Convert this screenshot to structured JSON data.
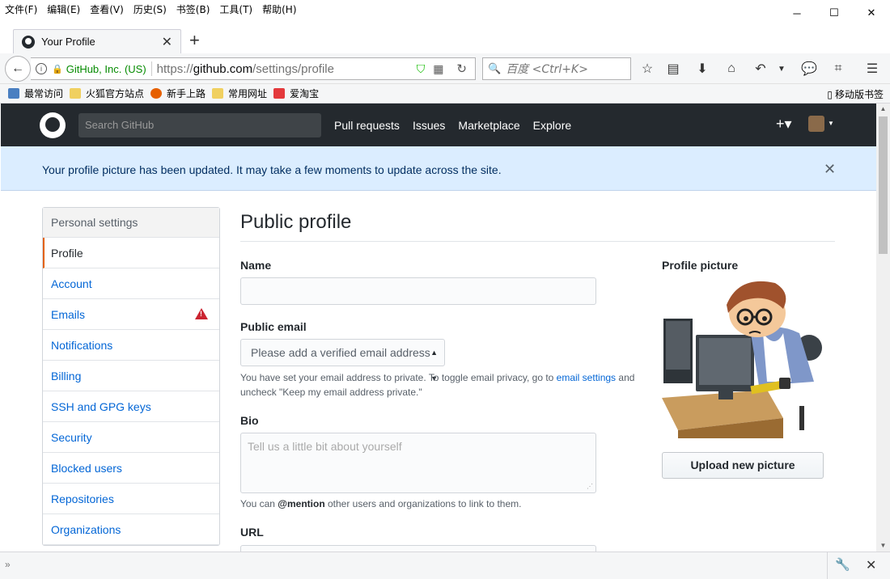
{
  "menubar": {
    "items": [
      "文件(F)",
      "编辑(E)",
      "查看(V)",
      "历史(S)",
      "书签(B)",
      "工具(T)",
      "帮助(H)"
    ]
  },
  "window_controls": {
    "minimize": "─",
    "maximize": "☐",
    "close": "✕"
  },
  "tab": {
    "title": "Your Profile",
    "close": "✕",
    "new_tab": "+"
  },
  "navbar": {
    "back": "←",
    "info": "i",
    "org": "GitHub, Inc. (US)",
    "url_prefix": "https://",
    "url_host": "github.com",
    "url_path": "/settings/profile",
    "search_placeholder": "百度 <Ctrl+K>",
    "toolbar_icons": [
      "star-icon",
      "reading-list-icon",
      "download-icon",
      "home-icon",
      "undo-icon",
      "dropdown-icon",
      "chat-icon",
      "crop-icon",
      "menu-icon"
    ]
  },
  "bookmarks": {
    "items": [
      {
        "label": "最常访问",
        "color": "#4a7fc1"
      },
      {
        "label": "火狐官方站点",
        "color": "#f0d060"
      },
      {
        "label": "新手上路",
        "color": "#e66000"
      },
      {
        "label": "常用网址",
        "color": "#f0d060"
      },
      {
        "label": "爱淘宝",
        "color": "#e4393c"
      }
    ],
    "mobile": "移动版书签"
  },
  "github": {
    "search_placeholder": "Search GitHub",
    "nav": [
      "Pull requests",
      "Issues",
      "Marketplace",
      "Explore"
    ],
    "plus": "+▾",
    "caret": "▼"
  },
  "flash": {
    "message": "Your profile picture has been updated. It may take a few moments to update across the site.",
    "close": "✕"
  },
  "sidebar": {
    "header": "Personal settings",
    "items": [
      {
        "label": "Profile",
        "selected": true
      },
      {
        "label": "Account"
      },
      {
        "label": "Emails",
        "warning": true
      },
      {
        "label": "Notifications"
      },
      {
        "label": "Billing"
      },
      {
        "label": "SSH and GPG keys"
      },
      {
        "label": "Security"
      },
      {
        "label": "Blocked users"
      },
      {
        "label": "Repositories"
      },
      {
        "label": "Organizations"
      }
    ]
  },
  "main": {
    "title": "Public profile",
    "name_label": "Name",
    "email_label": "Public email",
    "email_select": "Please add a verified email address",
    "email_note_1": "You have set your email address to private. To toggle email privacy, go to",
    "email_note_link": "email settings",
    "email_note_2": "and",
    "email_note_3": "uncheck \"Keep my email address private.\"",
    "bio_label": "Bio",
    "bio_placeholder": "Tell us a little bit about yourself",
    "bio_note_1": "You can",
    "bio_note_mention": "@mention",
    "bio_note_2": "other users and organizations to link to them.",
    "url_label": "URL",
    "picture_label": "Profile picture",
    "upload_button": "Upload new picture"
  },
  "colors": {
    "gh_header": "#24292e",
    "link": "#0366d6",
    "flash_bg": "#dbedff",
    "selected_accent": "#e36209",
    "warning": "#cb2431"
  }
}
